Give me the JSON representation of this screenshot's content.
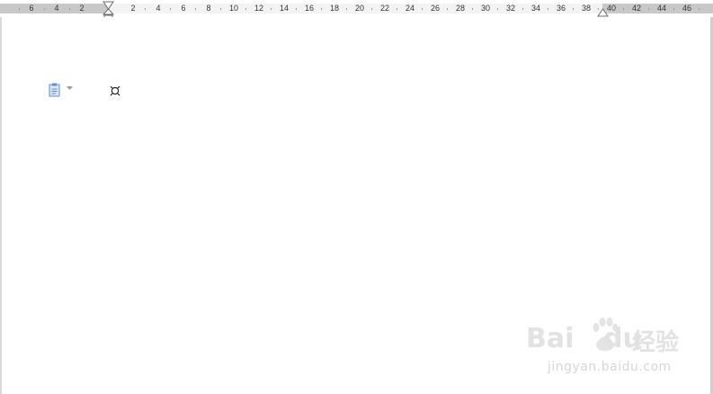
{
  "ruler": {
    "left_numbers": [
      "6",
      "4",
      "2"
    ],
    "right_numbers": [
      "2",
      "4",
      "6",
      "8",
      "10",
      "12",
      "14",
      "16",
      "18",
      "20",
      "22",
      "24",
      "26",
      "28",
      "30",
      "32",
      "34",
      "36",
      "38",
      "40",
      "42",
      "44",
      "46"
    ]
  },
  "document": {
    "paste_options_icon": "paste-options-icon",
    "paragraph_mark": "¤"
  },
  "watermark": {
    "logo_bai": "Bai",
    "logo_du": "du",
    "logo_jingyan": "经验",
    "url": "jingyan.baidu.com"
  },
  "colors": {
    "ruler_margin": "#c8c8c8",
    "ruler_text_area": "#f3f3f3",
    "icon_blue": "#5b8fd6"
  }
}
